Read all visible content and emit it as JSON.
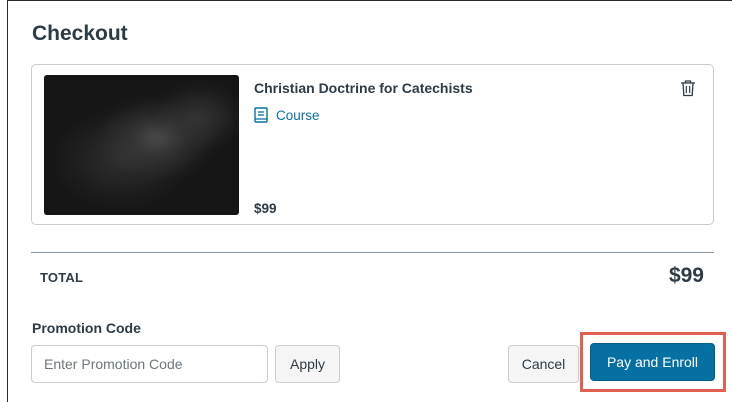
{
  "checkout": {
    "title": "Checkout"
  },
  "cart_item": {
    "name": "Christian Doctrine for Catechists",
    "type_label": "Course",
    "price": "$99",
    "type_icon": "course-book-icon",
    "remove_icon": "trash-icon"
  },
  "summary": {
    "total_label": "TOTAL",
    "total_value": "$99"
  },
  "promotion": {
    "label": "Promotion Code",
    "placeholder": "Enter Promotion Code",
    "value": "",
    "apply_label": "Apply"
  },
  "actions": {
    "cancel_label": "Cancel",
    "pay_label": "Pay and Enroll"
  },
  "colors": {
    "accent": "#0770a3",
    "highlight": "#e2604f",
    "text": "#2d3b45"
  }
}
